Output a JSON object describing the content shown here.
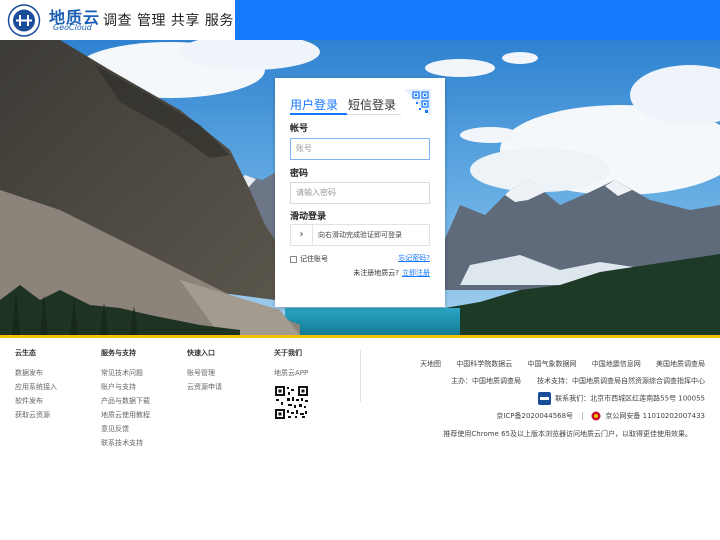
{
  "header": {
    "logo_cn": "地质云",
    "logo_en": "GeoCloud",
    "slogan": "调查 管理 共享 服务",
    "accent_color": "#1677ff"
  },
  "login": {
    "tabs": [
      {
        "label": "用户登录",
        "active": true
      },
      {
        "label": "短信登录",
        "active": false
      }
    ],
    "account_label": "帐号",
    "account_placeholder": "账号",
    "password_label": "密码",
    "password_placeholder": "请输入密码",
    "slide_label": "滑动登录",
    "slide_handle_icon": "chevron-right-icon",
    "slide_hint": "向右滑动完成验证即可登录",
    "remember_label": "记住账号",
    "remember_checked": false,
    "forgot_label": "忘记密码?",
    "register_prompt": "未注册地质云?",
    "register_link": "立即注册"
  },
  "footer": {
    "columns": [
      {
        "title": "云生态",
        "items": [
          "数据发布",
          "应用系统接入",
          "软件发布",
          "获取云资源"
        ]
      },
      {
        "title": "服务与支持",
        "items": [
          "常见技术问题",
          "账户与支持",
          "产品与数据下载",
          "地质云使用教程",
          "意见反馈",
          "联系技术支持"
        ]
      },
      {
        "title": "快速入口",
        "items": [
          "账号管理",
          "云资源申请"
        ]
      },
      {
        "title": "关于我们",
        "items": [
          "地质云APP"
        ]
      }
    ],
    "links": [
      "天地图",
      "中国科学院数据云",
      "中国气象数据网",
      "中国地震信息网",
      "美国地质调查局"
    ],
    "sponsor": "主办：中国地质调查局",
    "tech_support": "技术支持：中国地质调查局自然资源综合调查指挥中心",
    "contact": "联系我们：北京市西城区红莲南路55号 100055",
    "icp": "京ICP备2020044568号",
    "police": "京公网安备 11010202007433",
    "browser_tip": "推荐使用Chrome 65及以上版本浏览器访问地质云门户，以取得更佳使用效果。",
    "yellow_color": "#f2c200"
  }
}
